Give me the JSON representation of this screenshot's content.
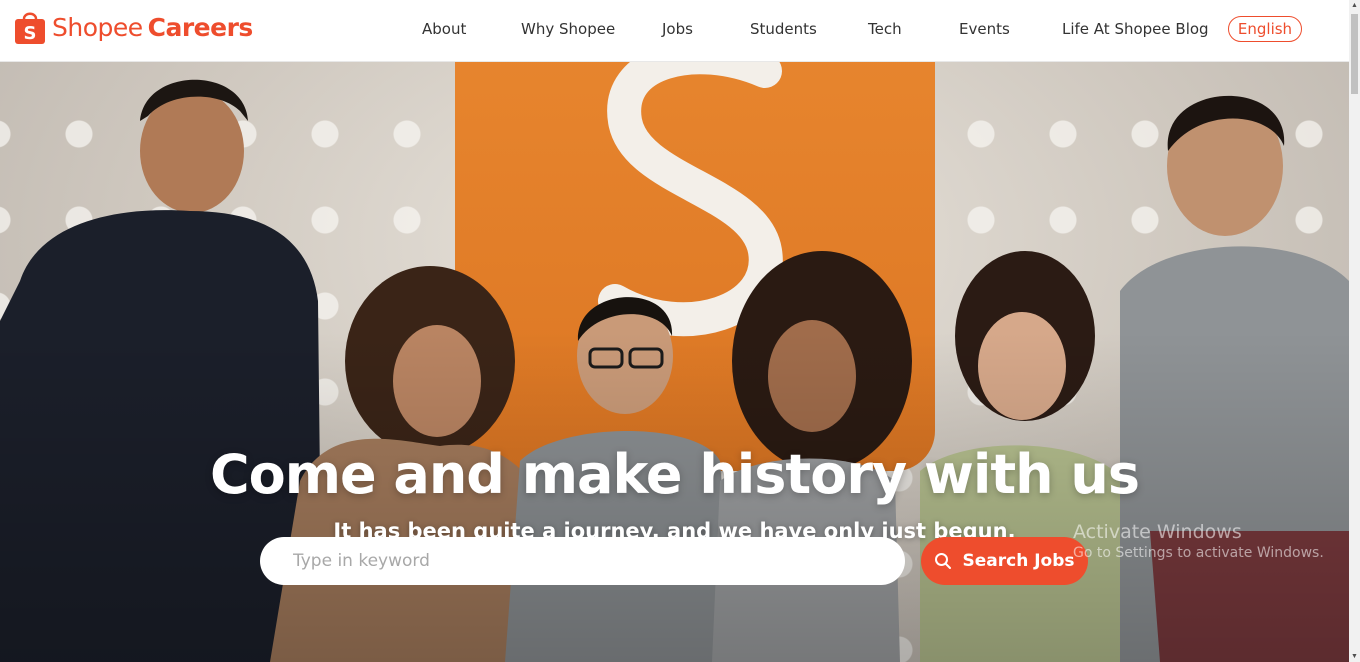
{
  "brand": {
    "name_part1": "Shopee",
    "name_part2": "Careers",
    "color": "#ee4d2d"
  },
  "nav": {
    "items": [
      {
        "label": "About"
      },
      {
        "label": "Why Shopee"
      },
      {
        "label": "Jobs"
      },
      {
        "label": "Students"
      },
      {
        "label": "Tech"
      },
      {
        "label": "Events"
      },
      {
        "label": "Life At Shopee Blog"
      }
    ],
    "language": "English"
  },
  "hero": {
    "title": "Come and make history with us",
    "subtitle": "It has been quite a journey, and we have only just begun.",
    "search_placeholder": "Type in keyword",
    "search_button": "Search Jobs",
    "search_icon": "search-icon"
  },
  "watermark": {
    "line1": "Activate Windows",
    "line2": "Go to Settings to activate Windows."
  }
}
